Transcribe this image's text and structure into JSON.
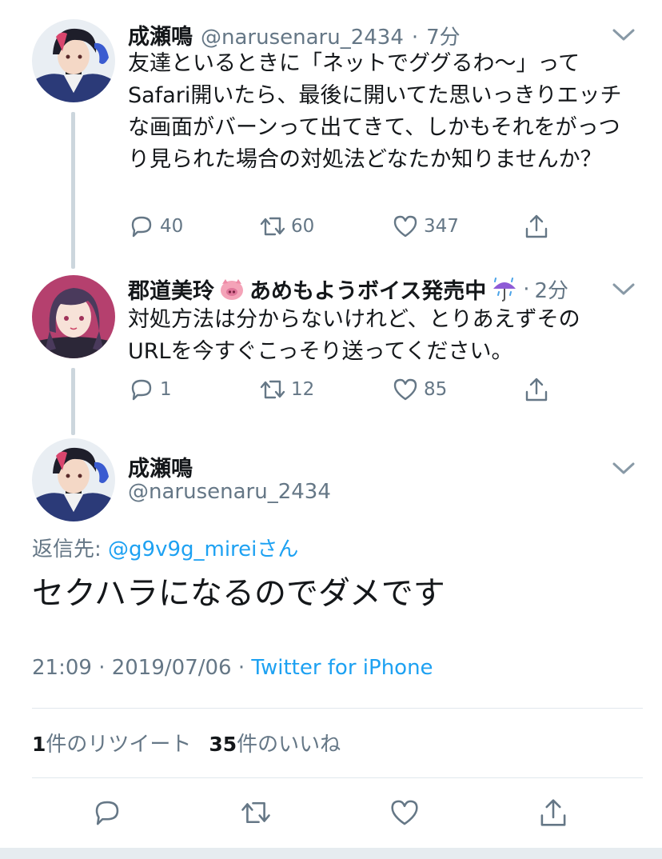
{
  "tweets": [
    {
      "name": "成瀬鳴",
      "handle": "@narusenaru_2434",
      "time": "7分",
      "text": "友達といるときに「ネットでググるわ〜」ってSafari開いたら、最後に開いてた思いっきりエッチな画面がバーンって出てきて、しかもそれをがっつり見られた場合の対処法どなたか知りませんか？",
      "replies": "40",
      "retweets": "60",
      "likes": "347"
    },
    {
      "name": "郡道美玲",
      "name_suffix": "あめもようボイス発売中",
      "handle": "",
      "time": "2分",
      "text": "対処方法は分からないけれど、とりあえずそのURLを今すぐこっそり送ってください。",
      "replies": "1",
      "retweets": "12",
      "likes": "85"
    }
  ],
  "main": {
    "name": "成瀬鳴",
    "handle": "@narusenaru_2434",
    "reply_to_label": "返信先: ",
    "reply_to_handle": "@g9v9g_mireiさん",
    "text": "セクハラになるのでダメです",
    "timestamp": "21:09 · 2019/07/06 · ",
    "source": "Twitter for iPhone",
    "retweet_count": "1",
    "retweet_label": "件のリツイート",
    "like_count": "35",
    "like_label": "件のいいね"
  },
  "colors": {
    "accent": "#1da1f2",
    "secondary_text": "#657786",
    "divider": "#e1e8ed",
    "thread_line": "#ccd6dd"
  },
  "icons": [
    "reply-icon",
    "retweet-icon",
    "like-icon",
    "share-icon",
    "chevron-down-icon",
    "pig-emoji-icon",
    "umbrella-rain-emoji-icon"
  ]
}
